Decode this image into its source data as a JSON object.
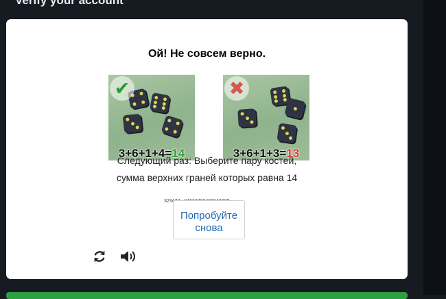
{
  "page": {
    "header_title": "Verify your account"
  },
  "captcha": {
    "heading": "Ой! Не совсем верно.",
    "examples": [
      {
        "status": "correct",
        "status_icon": "check-icon",
        "status_color": "#2b9a2e",
        "addends": "3+6+1+4=",
        "total": "14",
        "total_color": "#2fa13a"
      },
      {
        "status": "incorrect",
        "status_icon": "cross-icon",
        "status_color": "#d9534f",
        "addends": "3+6+1+3=",
        "total": "13",
        "total_color": "#e03a3a"
      }
    ],
    "hint": "Следующий раз: Выберите пару костей, сумма верхних граней которых равна 14",
    "session_id": "323477...34632700400840805",
    "retry_label": "Попробуйте снова",
    "refresh_icon": "refresh-icon",
    "audio_icon": "speaker-icon"
  },
  "colors": {
    "background": "#161b22",
    "card": "#ffffff",
    "link_blue": "#1e68b4",
    "success_bar": "#2ea043"
  }
}
